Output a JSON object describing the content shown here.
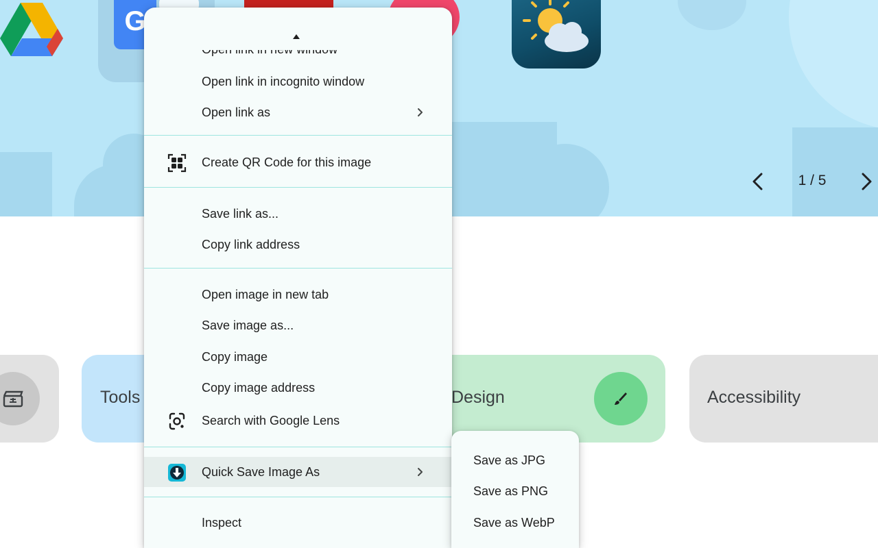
{
  "carousel": {
    "counter": "1 / 5",
    "prev_icon": "chevron-left-icon",
    "next_icon": "chevron-right-icon"
  },
  "categories": [
    {
      "label": "",
      "icon": "clapperboard-icon"
    },
    {
      "label": "Tools"
    },
    {
      "label": "Design",
      "icon": "paintbrush-icon"
    },
    {
      "label": "Accessibility"
    }
  ],
  "context_menu": {
    "scroll_up_icon": "triangle-up-icon",
    "items": [
      {
        "label": "Open link in new window"
      },
      {
        "label": "Open link in incognito window"
      },
      {
        "label": "Open link as",
        "has_submenu": true
      },
      {
        "label": "Create QR Code for this image",
        "icon": "qr-code-icon"
      },
      {
        "label": "Save link as..."
      },
      {
        "label": "Copy link address"
      },
      {
        "label": "Open image in new tab"
      },
      {
        "label": "Save image as..."
      },
      {
        "label": "Copy image"
      },
      {
        "label": "Copy image address"
      },
      {
        "label": "Search with Google Lens",
        "icon": "google-lens-icon"
      },
      {
        "label": "Quick Save Image As",
        "icon": "quick-save-extension-icon",
        "has_submenu": true,
        "highlighted": true
      },
      {
        "label": "Inspect"
      }
    ]
  },
  "submenu": {
    "items": [
      {
        "label": "Save as JPG"
      },
      {
        "label": "Save as PNG"
      },
      {
        "label": "Save as WebP"
      }
    ]
  },
  "colors": {
    "hero_background": "#b9e6f8",
    "menu_background": "#f6fcfb",
    "menu_separator": "#9ee5df",
    "menu_highlight": "#e6eeec",
    "tools_card": "#c3e5fb",
    "design_card": "#c4ecd0",
    "design_badge": "#6fd68f",
    "neutral_card": "#e2e2e2"
  }
}
